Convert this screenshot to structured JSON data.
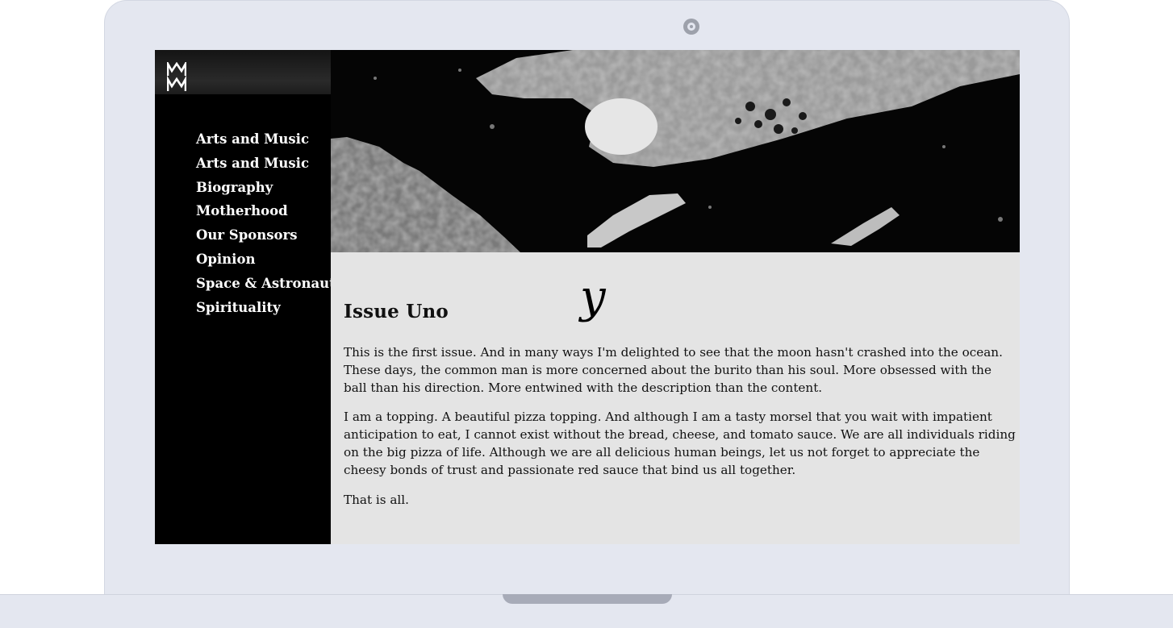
{
  "site": {
    "logo_glyph": "MM"
  },
  "nav": {
    "items": [
      "Arts and Music",
      "Arts and Music",
      "Biography",
      "Motherhood",
      "Our Sponsors",
      "Opinion",
      "Space & Astronauts",
      "Spirituality"
    ]
  },
  "article": {
    "title": "Issue Uno",
    "decorative_letter": "y",
    "paragraphs": [
      "This is the first issue. And in many ways I'm delighted to see that the moon hasn't crashed into the ocean. These days, the common man is more concerned about the burito than his soul. More obsessed with the ball than his direction. More entwined with the description than the content.",
      "I am a topping. A beautiful pizza topping. And although I am a tasty morsel that you wait with impatient anticipation to eat, I cannot exist without the bread, cheese, and tomato sauce. We are all individuals riding on the big pizza of life. Although we are all delicious human beings, let us not forget to appreciate the cheesy bonds of trust and passionate red sauce that bind us all together.",
      "That is all."
    ]
  },
  "colors": {
    "frame": "#e4e7f0",
    "sidebar": "#000000",
    "content_bg": "#e4e4e4",
    "nav_text": "#ffffff"
  }
}
